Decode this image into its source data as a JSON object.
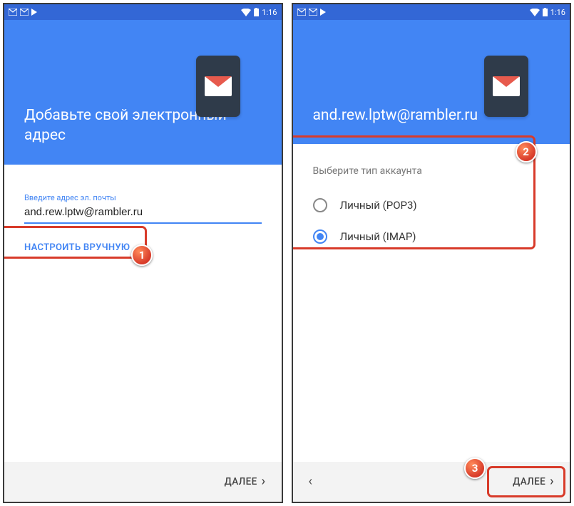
{
  "status": {
    "time": "1:16"
  },
  "left_screen": {
    "title": "Добавьте свой электронный адрес",
    "input_label": "Введите адрес эл. почты",
    "email_value": "and.rew.lptw@rambler.ru",
    "manual_setup": "НАСТРОИТЬ ВРУЧНУЮ",
    "next": "ДАЛЕЕ"
  },
  "right_screen": {
    "title": "and.rew.lptw@rambler.ru",
    "choose_label": "Выберите тип аккаунта",
    "option_pop3": "Личный (POP3)",
    "option_imap": "Личный (IMAP)",
    "next": "ДАЛЕЕ"
  },
  "callouts": {
    "one": "1",
    "two": "2",
    "three": "3"
  }
}
